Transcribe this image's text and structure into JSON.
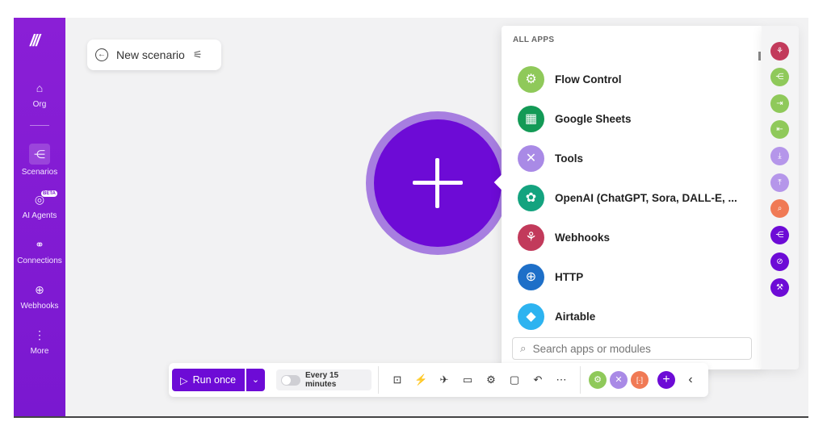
{
  "sidebar": {
    "logo": "///",
    "items": [
      {
        "label": "Org",
        "icon": "home-icon",
        "glyph": "⌂"
      },
      {
        "label": "Scenarios",
        "icon": "share-nodes-icon",
        "glyph": "⋲"
      },
      {
        "label": "AI Agents",
        "icon": "agent-icon",
        "glyph": "◎",
        "badge": "BETA"
      },
      {
        "label": "Connections",
        "icon": "link-icon",
        "glyph": "⚭"
      },
      {
        "label": "Webhooks",
        "icon": "globe-icon",
        "glyph": "⊕"
      },
      {
        "label": "More",
        "icon": "kebab-icon",
        "glyph": "⋮"
      }
    ]
  },
  "scenario": {
    "title": "New scenario",
    "back_glyph": "←",
    "settings_glyph": "⚟"
  },
  "apps_panel": {
    "heading": "ALL APPS",
    "apps": [
      {
        "name": "Flow Control",
        "icon": "gear-icon",
        "glyph": "⚙",
        "color": "#8fc95a"
      },
      {
        "name": "Google Sheets",
        "icon": "sheets-icon",
        "glyph": "▦",
        "color": "#139a56"
      },
      {
        "name": "Tools",
        "icon": "tools-icon",
        "glyph": "✕",
        "color": "#a98ae6"
      },
      {
        "name": "OpenAI (ChatGPT, Sora, DALL-E, ...",
        "icon": "openai-icon",
        "glyph": "✿",
        "color": "#14a37f"
      },
      {
        "name": "Webhooks",
        "icon": "webhook-icon",
        "glyph": "⚘",
        "color": "#c23a5b"
      },
      {
        "name": "HTTP",
        "icon": "globe-icon",
        "glyph": "⊕",
        "color": "#1e6fc8"
      },
      {
        "name": "Airtable",
        "icon": "airtable-icon",
        "glyph": "◆",
        "color": "#2db3f0"
      }
    ],
    "search_placeholder": "Search apps or modules"
  },
  "rail": [
    {
      "icon": "webhook-icon",
      "glyph": "⚘",
      "color": "#c23a5b"
    },
    {
      "icon": "router-icon",
      "glyph": "⋲",
      "color": "#8fc95a"
    },
    {
      "icon": "iterator-icon",
      "glyph": "⇥",
      "color": "#8fc95a"
    },
    {
      "icon": "aggregator-icon",
      "glyph": "⇤",
      "color": "#8fc95a"
    },
    {
      "icon": "import-icon",
      "glyph": "⤓",
      "color": "#b596ea"
    },
    {
      "icon": "export-icon",
      "glyph": "⤒",
      "color": "#b596ea"
    },
    {
      "icon": "search-module-icon",
      "glyph": "⌕",
      "color": "#f07a55"
    },
    {
      "icon": "share-icon",
      "glyph": "⋲",
      "color": "#6d0bd6"
    },
    {
      "icon": "compass-icon",
      "glyph": "⊘",
      "color": "#6d0bd6"
    },
    {
      "icon": "wrench-icon",
      "glyph": "⚒",
      "color": "#6d0bd6"
    }
  ],
  "toolbar": {
    "run_label": "Run once",
    "run_glyph": "▷",
    "dropdown_glyph": "⌄",
    "schedule_label": "Every 15 minutes",
    "tools": [
      {
        "icon": "save-icon",
        "glyph": "⊡"
      },
      {
        "icon": "magic-wand-icon",
        "glyph": "⚡"
      },
      {
        "icon": "plane-icon",
        "glyph": "✈"
      },
      {
        "icon": "flow-icon",
        "glyph": "▭"
      },
      {
        "icon": "gear-icon",
        "glyph": "⚙"
      },
      {
        "icon": "note-icon",
        "glyph": "▢"
      },
      {
        "icon": "undo-icon",
        "glyph": "↶"
      },
      {
        "icon": "more-icon",
        "glyph": "⋯"
      }
    ],
    "favorites": [
      {
        "icon": "flow-control-icon",
        "glyph": "⚙",
        "color": "#8fc95a"
      },
      {
        "icon": "tools-icon",
        "glyph": "✕",
        "color": "#a98ae6"
      },
      {
        "icon": "text-parser-icon",
        "glyph": "[·]",
        "color": "#f07a55"
      },
      {
        "icon": "add-icon",
        "glyph": "+",
        "color": "#6d0bd6"
      }
    ],
    "collapse_glyph": "‹"
  }
}
